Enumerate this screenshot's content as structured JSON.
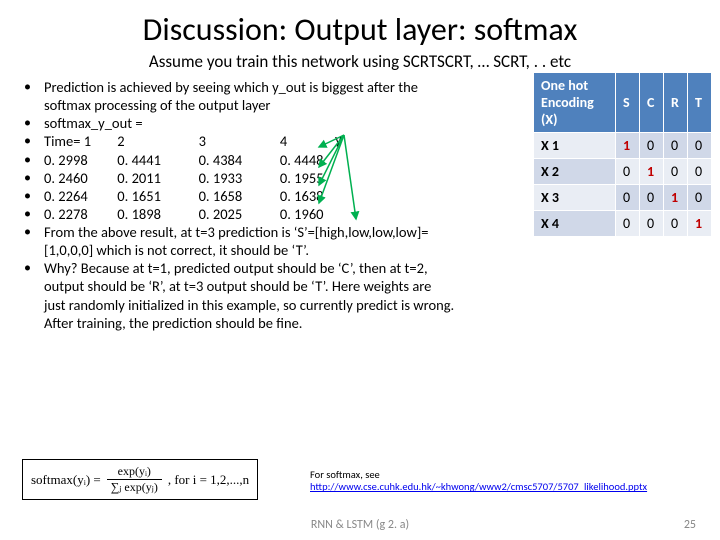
{
  "title": "Discussion: Output layer: softmax",
  "subtitle": "Assume you train this network using SCRTSCRT, … SCRT, . . etc",
  "bullets": {
    "b1": "Prediction is achieved by seeing which y_out is biggest after the softmax processing of the output layer",
    "b2": "softmax_y_out =",
    "time_row": {
      "c0": "Time= 1",
      "c1": "2",
      "c2": "3",
      "c3": "4"
    },
    "r1": {
      "c0": " 0. 2998",
      "c1": "0. 4441",
      "c2": "0. 4384",
      "c3": "0. 4448"
    },
    "r2": {
      "c0": " 0. 2460",
      "c1": "0. 2011",
      "c2": "0. 1933",
      "c3": "0. 1955"
    },
    "r3": {
      "c0": " 0. 2264",
      "c1": "0. 1651",
      "c2": "0. 1658",
      "c3": "0. 1638"
    },
    "r4": {
      "c0": " 0. 2278",
      "c1": "0. 1898",
      "c2": "0. 2025",
      "c3": "0. 1960"
    },
    "b8": "From the above result, at t=3 prediction is ‘S’=[high,low,low,low]=[1,0,0,0] which is not correct, it should be ‘T’.",
    "b9": "Why? Because at t=1, predicted output should  be ‘C’, then at t=2, output should be ‘R’, at t=3 output should be ‘T’. Here weights are just randomly initialized in this example, so currently predict is wrong. After training, the prediction should be fine."
  },
  "ylabel": "y",
  "encoding": {
    "head": [
      "One hot Encoding (X)",
      "S",
      "C",
      "R",
      "T"
    ],
    "rows": [
      {
        "label": "X 1",
        "cells": [
          "1",
          "0",
          "0",
          "0"
        ],
        "hot": 0
      },
      {
        "label": "X 2",
        "cells": [
          "0",
          "1",
          "0",
          "0"
        ],
        "hot": 1
      },
      {
        "label": "X 3",
        "cells": [
          "0",
          "0",
          "1",
          "0"
        ],
        "hot": 2
      },
      {
        "label": "X 4",
        "cells": [
          "0",
          "0",
          "0",
          "1"
        ],
        "hot": 3
      }
    ]
  },
  "formula": {
    "lhs": "softmax(yᵢ) =",
    "num": "exp(yᵢ)",
    "den": "∑ⱼ exp(yⱼ)",
    "tail": ", for i = 1,2,...,n"
  },
  "softmax_note": {
    "text": "For softmax, see",
    "url_text": "http://www.cse.cuhk.edu.hk/~khwong/www2/cmsc5707/5707_likelihood.pptx"
  },
  "footer": "RNN & LSTM (g 2. a)",
  "pagenum": "25"
}
